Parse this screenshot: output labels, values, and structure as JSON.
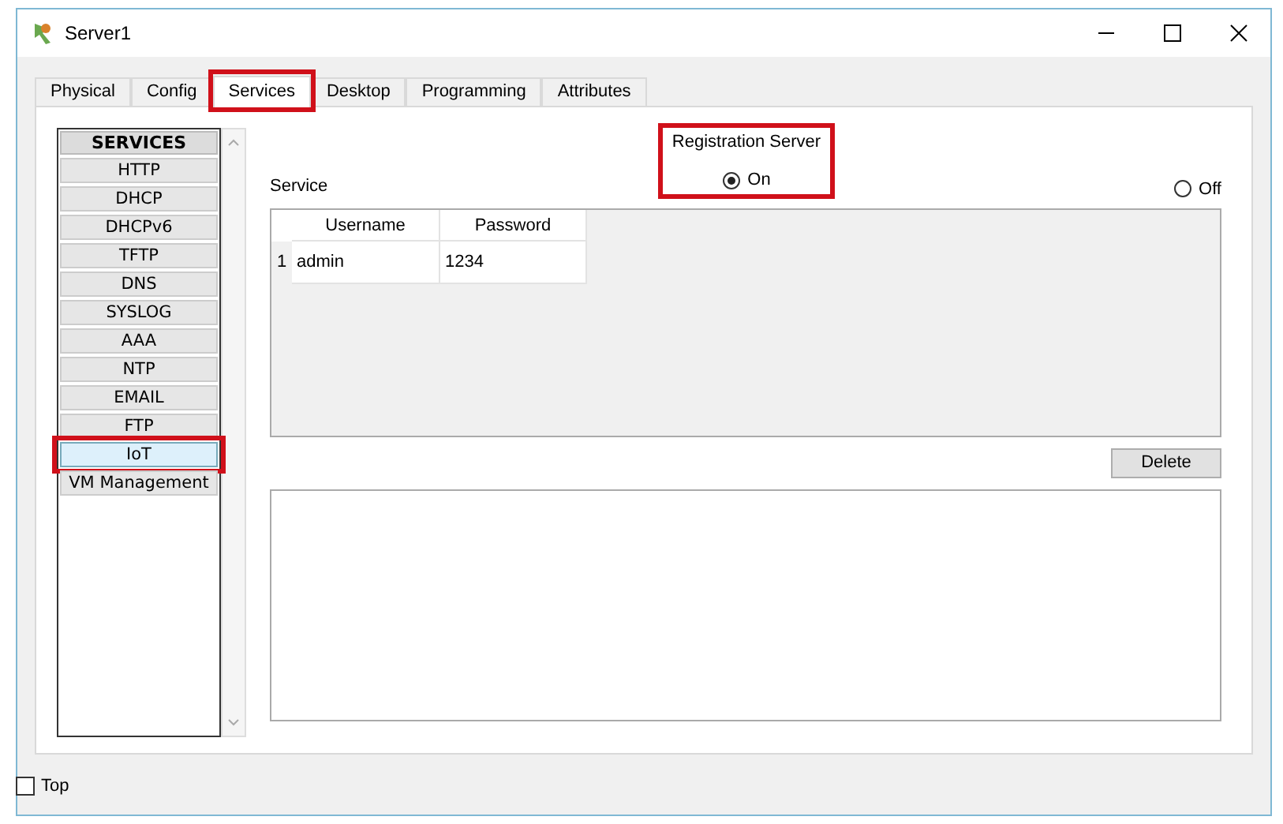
{
  "window": {
    "title": "Server1"
  },
  "tabs": [
    {
      "label": "Physical",
      "selected": false,
      "highlighted": false
    },
    {
      "label": "Config",
      "selected": false,
      "highlighted": false
    },
    {
      "label": "Services",
      "selected": true,
      "highlighted": true
    },
    {
      "label": "Desktop",
      "selected": false,
      "highlighted": false
    },
    {
      "label": "Programming",
      "selected": false,
      "highlighted": false
    },
    {
      "label": "Attributes",
      "selected": false,
      "highlighted": false
    }
  ],
  "services": {
    "header": "SERVICES",
    "items": [
      {
        "label": "HTTP",
        "selected": false,
        "highlighted": false
      },
      {
        "label": "DHCP",
        "selected": false,
        "highlighted": false
      },
      {
        "label": "DHCPv6",
        "selected": false,
        "highlighted": false
      },
      {
        "label": "TFTP",
        "selected": false,
        "highlighted": false
      },
      {
        "label": "DNS",
        "selected": false,
        "highlighted": false
      },
      {
        "label": "SYSLOG",
        "selected": false,
        "highlighted": false
      },
      {
        "label": "AAA",
        "selected": false,
        "highlighted": false
      },
      {
        "label": "NTP",
        "selected": false,
        "highlighted": false
      },
      {
        "label": "EMAIL",
        "selected": false,
        "highlighted": false
      },
      {
        "label": "FTP",
        "selected": false,
        "highlighted": false
      },
      {
        "label": "IoT",
        "selected": true,
        "highlighted": true
      },
      {
        "label": "VM Management",
        "selected": false,
        "highlighted": false
      }
    ]
  },
  "service_label": "Service",
  "registration_server": {
    "label": "Registration Server",
    "highlighted": true,
    "options": [
      {
        "label": "On",
        "selected": true
      },
      {
        "label": "Off",
        "selected": false
      }
    ]
  },
  "table": {
    "columns": [
      "Username",
      "Password"
    ],
    "rows": [
      {
        "index": "1",
        "cells": [
          "admin",
          "1234"
        ]
      }
    ]
  },
  "delete_button": "Delete",
  "top_checkbox": {
    "label": "Top",
    "checked": false
  }
}
